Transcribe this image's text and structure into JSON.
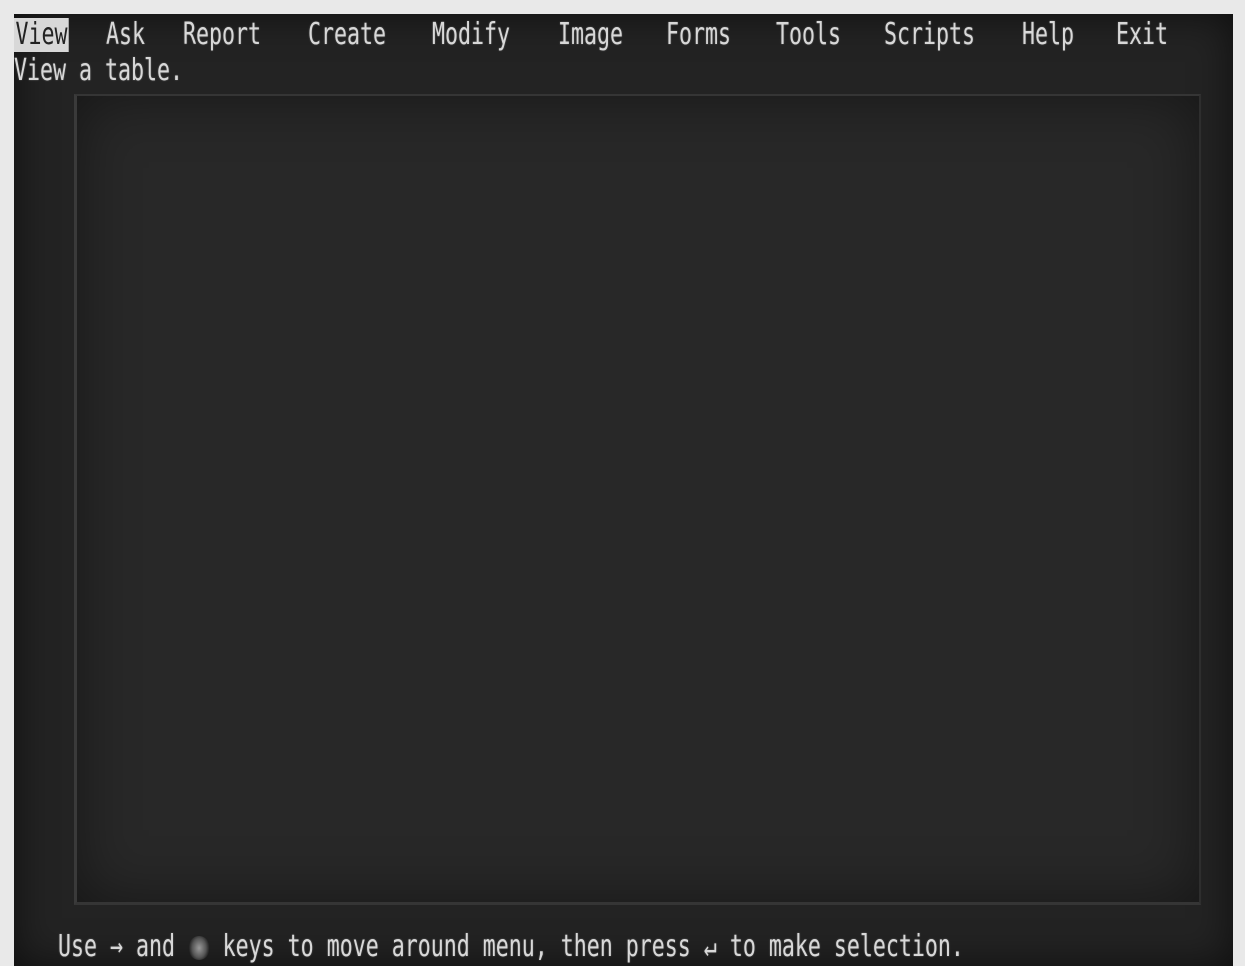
{
  "menu": {
    "items": [
      {
        "label": "View"
      },
      {
        "label": "Ask"
      },
      {
        "label": "Report"
      },
      {
        "label": "Create"
      },
      {
        "label": "Modify"
      },
      {
        "label": "Image"
      },
      {
        "label": "Forms"
      },
      {
        "label": "Tools"
      },
      {
        "label": "Scripts"
      },
      {
        "label": "Help"
      },
      {
        "label": "Exit"
      }
    ],
    "selected": "View"
  },
  "hint": {
    "text": "View a table."
  },
  "status": {
    "prefix": "Use",
    "right_arrow": "→",
    "and_word": "and",
    "middle": "keys to move around menu, then press",
    "enter_symbol": "↵",
    "suffix": "to make selection."
  }
}
